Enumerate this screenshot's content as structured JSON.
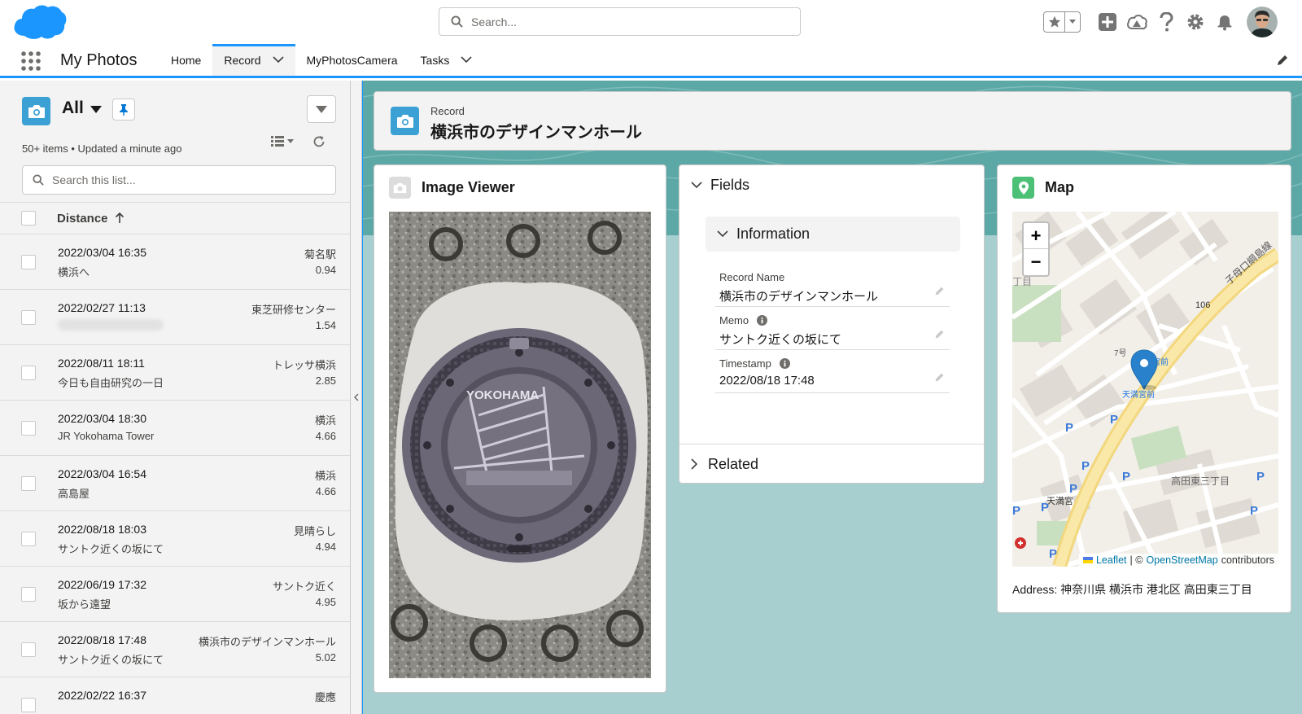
{
  "header": {
    "search_placeholder": "Search...",
    "avatar_label": "user avatar"
  },
  "nav": {
    "app_name": "My Photos",
    "items": [
      {
        "label": "Home",
        "has_menu": false,
        "active": false
      },
      {
        "label": "Record",
        "has_menu": true,
        "active": true
      },
      {
        "label": "MyPhotosCamera",
        "has_menu": false,
        "active": false
      },
      {
        "label": "Tasks",
        "has_menu": true,
        "active": false
      }
    ]
  },
  "list": {
    "view_name": "All",
    "meta": "50+ items • Updated a minute ago",
    "search_placeholder": "Search this list...",
    "column": "Distance",
    "rows": [
      {
        "title": "2022/03/04 16:35",
        "sub": "横浜へ",
        "place": "菊名駅",
        "distance": "0.94"
      },
      {
        "title": "2022/02/27 11:13",
        "sub": "",
        "place": "東芝研修センター",
        "distance": "1.54"
      },
      {
        "title": "2022/08/11 18:11",
        "sub": "今日も自由研究の一日",
        "place": "トレッサ横浜",
        "distance": "2.85"
      },
      {
        "title": "2022/03/04 18:30",
        "sub": "JR Yokohama Tower",
        "place": "横浜",
        "distance": "4.66"
      },
      {
        "title": "2022/03/04 16:54",
        "sub": "高島屋",
        "place": "横浜",
        "distance": "4.66"
      },
      {
        "title": "2022/08/18 18:03",
        "sub": "サントク近くの坂にて",
        "place": "見晴らし",
        "distance": "4.94"
      },
      {
        "title": "2022/06/19 17:32",
        "sub": "坂から遠望",
        "place": "サントク近く",
        "distance": "4.95"
      },
      {
        "title": "2022/08/18 17:48",
        "sub": "サントク近くの坂にて",
        "place": "横浜市のデザインマンホール",
        "distance": "5.02"
      },
      {
        "title": "2022/02/22 16:37",
        "sub": "",
        "place": "慶應",
        "distance": ""
      }
    ]
  },
  "record": {
    "type_label": "Record",
    "title": "横浜市のデザインマンホール"
  },
  "image_viewer": {
    "title": "Image Viewer",
    "manhole_text": "YOKOHAMA"
  },
  "fields": {
    "title": "Fields",
    "section": "Information",
    "items": [
      {
        "label": "Record Name",
        "value": "横浜市のデザインマンホール",
        "info": false
      },
      {
        "label": "Memo",
        "value": "サントク近くの坂にて",
        "info": true
      },
      {
        "label": "Timestamp",
        "value": "2022/08/18 17:48",
        "info": true
      }
    ],
    "related": "Related"
  },
  "map": {
    "title": "Map",
    "zoom_in": "+",
    "zoom_out": "−",
    "labels": {
      "road_number": "106",
      "line_name": "子母口綱島線",
      "station": "天満宮前",
      "station_short": "宮前",
      "block": "7号",
      "area": "高田東三丁目",
      "shrine": "天満宮",
      "left_fragment": "丁目"
    },
    "attribution": {
      "leaflet": "Leaflet",
      "sep": "| ©",
      "osm": "OpenStreetMap",
      "contributors": "contributors"
    },
    "address": "Address: 神奈川県 横浜市 港北区 高田東三丁目"
  },
  "colors": {
    "brand_blue": "#1b96ff",
    "record_icon": "#3ba0d3",
    "map_icon": "#4bc076",
    "workspace_bg": "#a8cfd0"
  }
}
